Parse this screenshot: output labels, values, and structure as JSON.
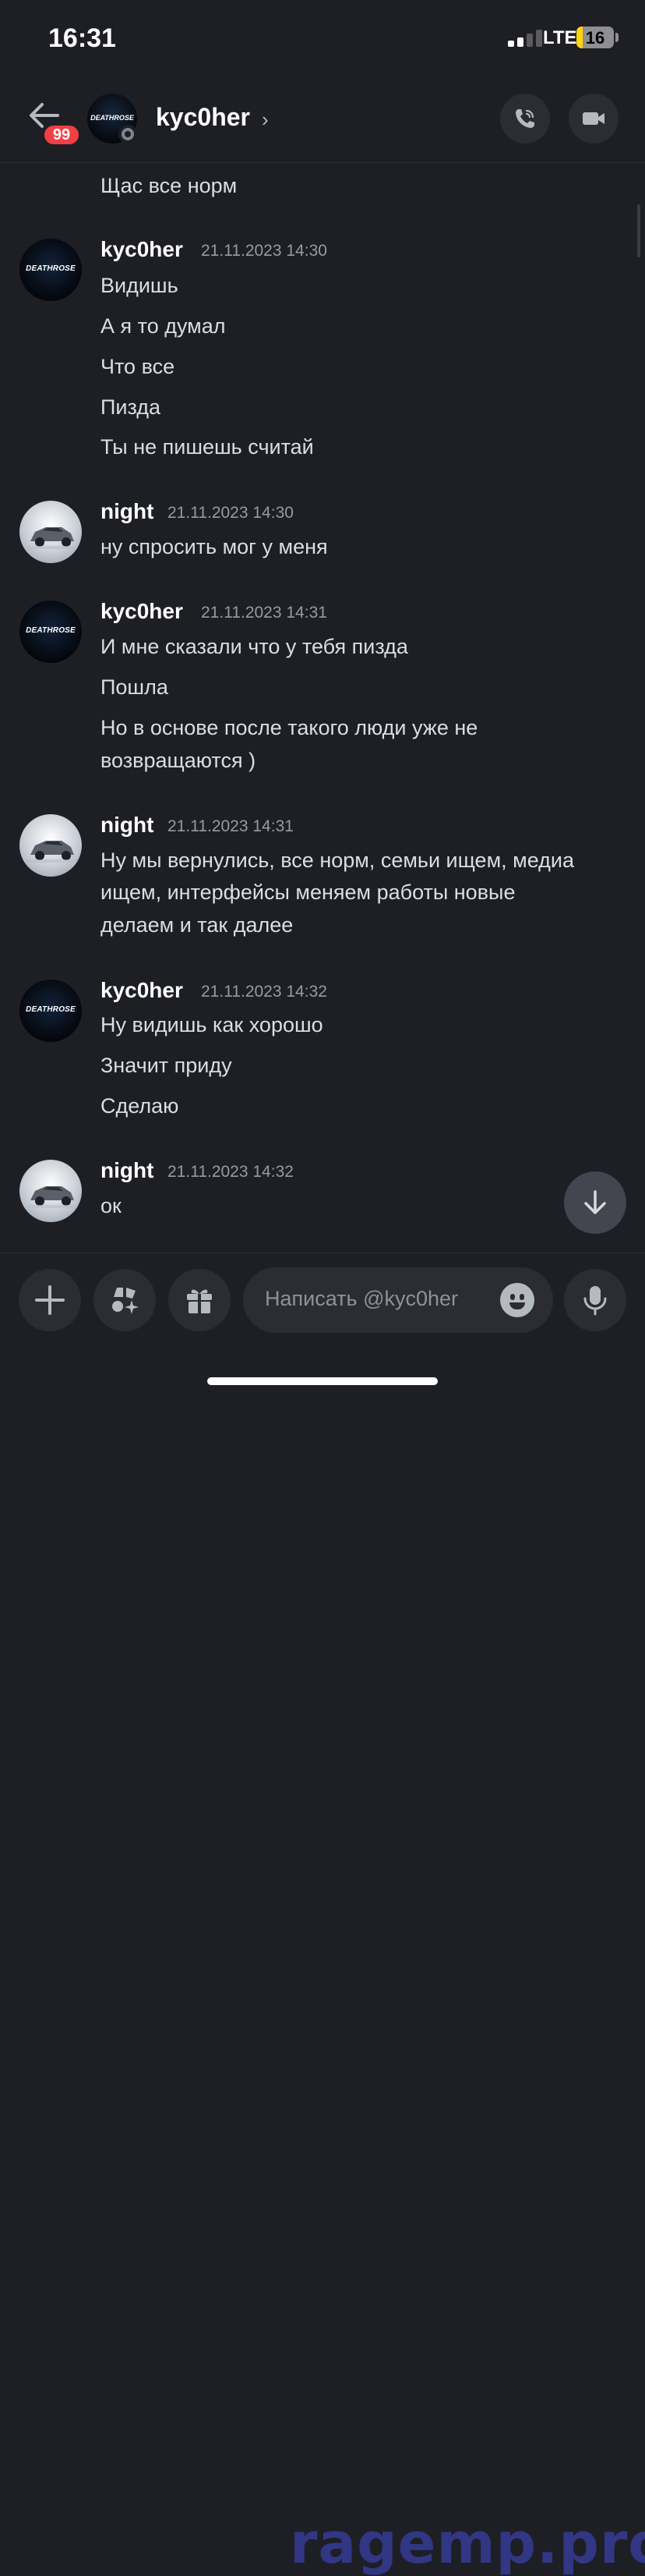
{
  "status_bar": {
    "time": "16:31",
    "network": "LTE",
    "battery": "16",
    "battery_level": 0.16
  },
  "header": {
    "unread_badge": "99",
    "channel_name": "kyc0her",
    "avatar_logo": "DEATHROSE"
  },
  "icons": {
    "back": "arrow-left-icon",
    "chevron": "chevron-right-icon",
    "call": "phone-icon",
    "video": "video-camera-icon",
    "scroll_down": "arrow-down-icon",
    "add": "plus-icon",
    "apps": "apps-icon",
    "gift": "gift-icon",
    "emoji": "smile-icon",
    "mic": "microphone-icon"
  },
  "messages": {
    "orphan": "Щас все норм",
    "groups": [
      {
        "author": "kyc0her",
        "timestamp": "21.11.2023 14:30",
        "avatar": "DEATHROSE",
        "lines": [
          "Видишь",
          "А я то думал",
          "Что все",
          "Пизда",
          "Ты не пишешь считай"
        ]
      },
      {
        "author": "night",
        "timestamp": "21.11.2023 14:30",
        "avatar": "car",
        "lines": [
          "ну спросить мог у меня"
        ]
      },
      {
        "author": "kyc0her",
        "timestamp": "21.11.2023 14:31",
        "avatar": "DEATHROSE",
        "lines": [
          "И мне сказали что у тебя пизда",
          "Пошла",
          "Но в основе после такого люди уже не",
          "возвращаются )"
        ]
      },
      {
        "author": "night",
        "timestamp": "21.11.2023 14:31",
        "avatar": "car",
        "lines": [
          "Ну мы вернулись, все норм, семьи ищем, медиа",
          "ищем, интерфейсы меняем работы новые",
          "делаем и так далее"
        ]
      },
      {
        "author": "kyc0her",
        "timestamp": "21.11.2023 14:32",
        "avatar": "DEATHROSE",
        "lines": [
          "Ну видишь как хорошо",
          "Значит приду",
          "Сделаю"
        ]
      },
      {
        "author": "night",
        "timestamp": "21.11.2023 14:32",
        "avatar": "car",
        "lines": [
          "ок"
        ]
      }
    ]
  },
  "composer": {
    "placeholder": "Написать @kyc0her"
  },
  "watermark": "ragemp.pro",
  "colors": {
    "background": "#1e1f24",
    "surface": "#2b2d33",
    "badge": "#f23f43",
    "battery": "#ffd60a",
    "watermark": "#343a8f"
  }
}
